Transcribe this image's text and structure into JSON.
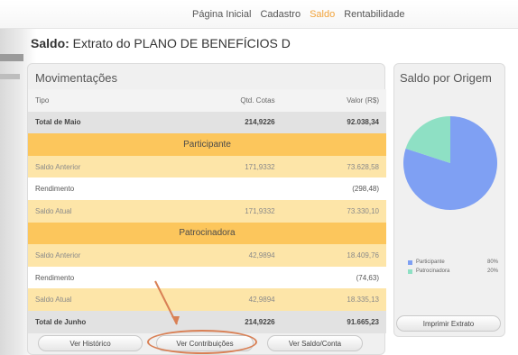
{
  "nav": {
    "items": [
      {
        "label": "Página Inicial",
        "active": false
      },
      {
        "label": "Cadastro",
        "active": false
      },
      {
        "label": "Saldo",
        "active": true
      },
      {
        "label": "Rentabilidade",
        "active": false
      }
    ]
  },
  "page": {
    "title_prefix": "Saldo:",
    "title_rest": " Extrato do PLANO DE BENEFÍCIOS D"
  },
  "movimentacoes": {
    "title": "Movimentações",
    "header": {
      "tipo": "Tipo",
      "cotas": "Qtd. Cotas",
      "valor": "Valor (R$)"
    },
    "total_maio": {
      "label": "Total de Maio",
      "cotas": "214,9226",
      "valor": "92.038,34"
    },
    "participante": {
      "section": "Participante",
      "saldo_anterior": {
        "label": "Saldo Anterior",
        "cotas": "171,9332",
        "valor": "73.628,58"
      },
      "rendimento": {
        "label": "Rendimento",
        "cotas": "",
        "valor": "(298,48)"
      },
      "saldo_atual": {
        "label": "Saldo Atual",
        "cotas": "171,9332",
        "valor": "73.330,10"
      }
    },
    "patrocinadora": {
      "section": "Patrocinadora",
      "saldo_anterior": {
        "label": "Saldo Anterior",
        "cotas": "42,9894",
        "valor": "18.409,76"
      },
      "rendimento": {
        "label": "Rendimento",
        "cotas": "",
        "valor": "(74,63)"
      },
      "saldo_atual": {
        "label": "Saldo Atual",
        "cotas": "42,9894",
        "valor": "18.335,13"
      }
    },
    "total_junho": {
      "label": "Total de Junho",
      "cotas": "214,9226",
      "valor": "91.665,23"
    }
  },
  "buttons": {
    "historico": "Ver Histórico",
    "contribuicoes": "Ver Contribuições",
    "saldo_conta": "Ver Saldo/Conta",
    "imprimir": "Imprimir Extrato"
  },
  "saldo_origem": {
    "title": "Saldo por Origem"
  },
  "chart_data": {
    "type": "pie",
    "title": "Saldo por Origem",
    "categories": [
      "Participante",
      "Patrocinadora"
    ],
    "values": [
      80,
      20
    ],
    "labels": [
      "80%",
      "20%"
    ],
    "colors": [
      "#7fa0f3",
      "#8ee0c4"
    ],
    "legend": "bottom"
  },
  "colors": {
    "active_nav": "#f2a33a",
    "section_header": "#fcc65c",
    "yellow_row": "#fde5a8",
    "highlight": "#d98055"
  }
}
